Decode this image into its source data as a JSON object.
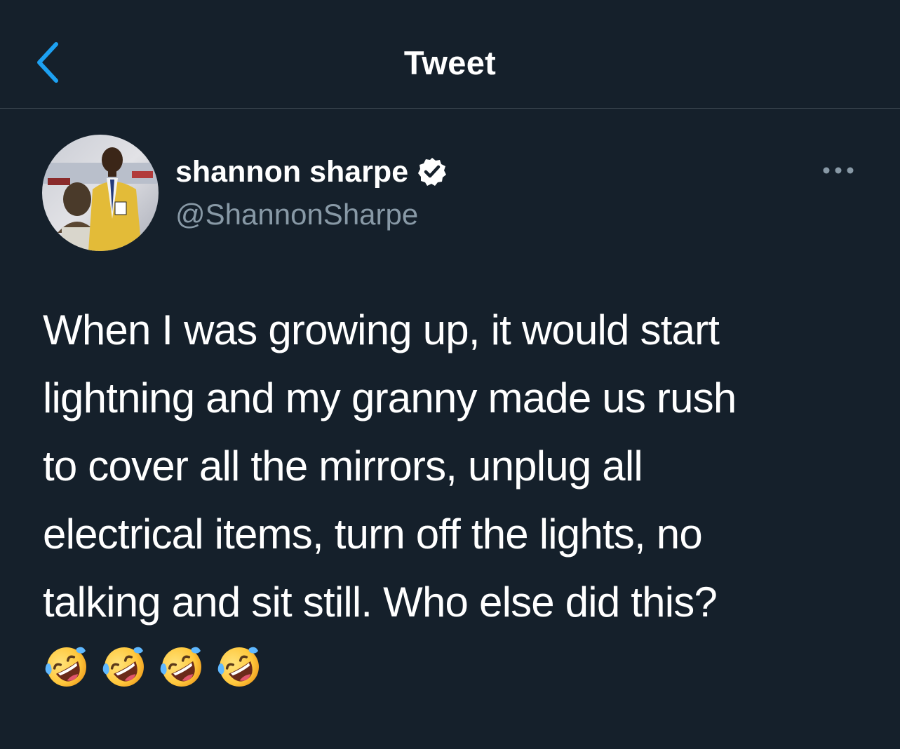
{
  "header": {
    "title": "Tweet"
  },
  "tweet": {
    "author": {
      "name": "shannon sharpe",
      "handle": "@ShannonSharpe",
      "verified": true
    },
    "text": "When I was growing up, it would start\nlightning and my granny made us rush\nto cover all the mirrors, unplug all\nelectrical items, turn off the lights, no\ntalking and sit still.  Who else did this?",
    "emojis": [
      "🤣",
      "🤣",
      "🤣",
      "🤣"
    ]
  },
  "icons": {
    "back": "chevron-left-icon",
    "verified": "verified-badge-icon",
    "more": "more-horizontal-icon",
    "emoji": "rolling-on-floor-laughing-emoji"
  },
  "colors": {
    "background": "#15202b",
    "accent": "#1da1f2",
    "secondary_text": "#8899a6",
    "divider": "#38444d"
  }
}
